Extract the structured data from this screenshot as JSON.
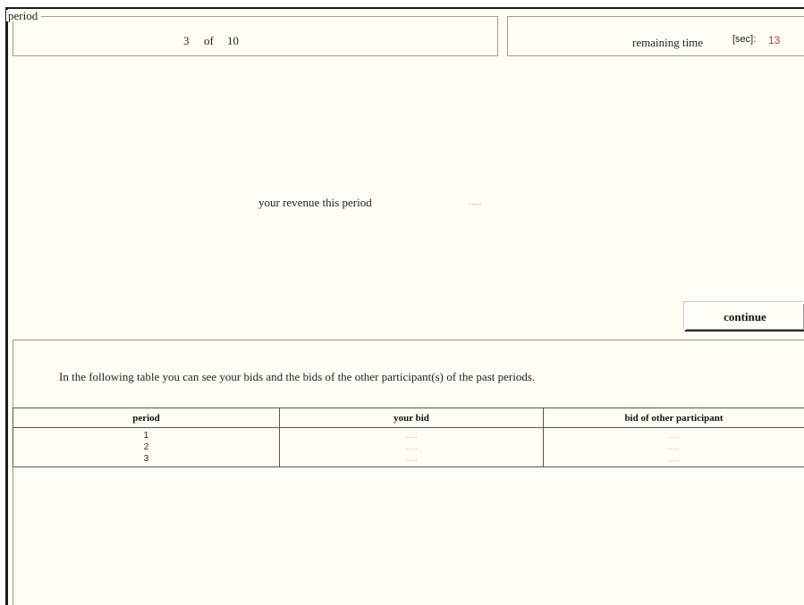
{
  "period": {
    "legend": "period",
    "current": "3",
    "of_label": "of",
    "total": "10"
  },
  "timer": {
    "label": "remaining time",
    "unit": "[sec]:",
    "value": "13",
    "value_color": "#e03030"
  },
  "revenue": {
    "label": "your revenue this period",
    "value": "....."
  },
  "continue_label": "continue",
  "history": {
    "info": "In the following table you can see your bids and the bids of the other participant(s) of the past periods.",
    "columns": [
      "period",
      "your bid",
      "bid of other participant"
    ],
    "rows": [
      {
        "period": "1",
        "your_bid": ".....",
        "other_bid": "....."
      },
      {
        "period": "2",
        "your_bid": ".....",
        "other_bid": "....."
      },
      {
        "period": "3",
        "your_bid": ".....",
        "other_bid": "....."
      }
    ]
  }
}
